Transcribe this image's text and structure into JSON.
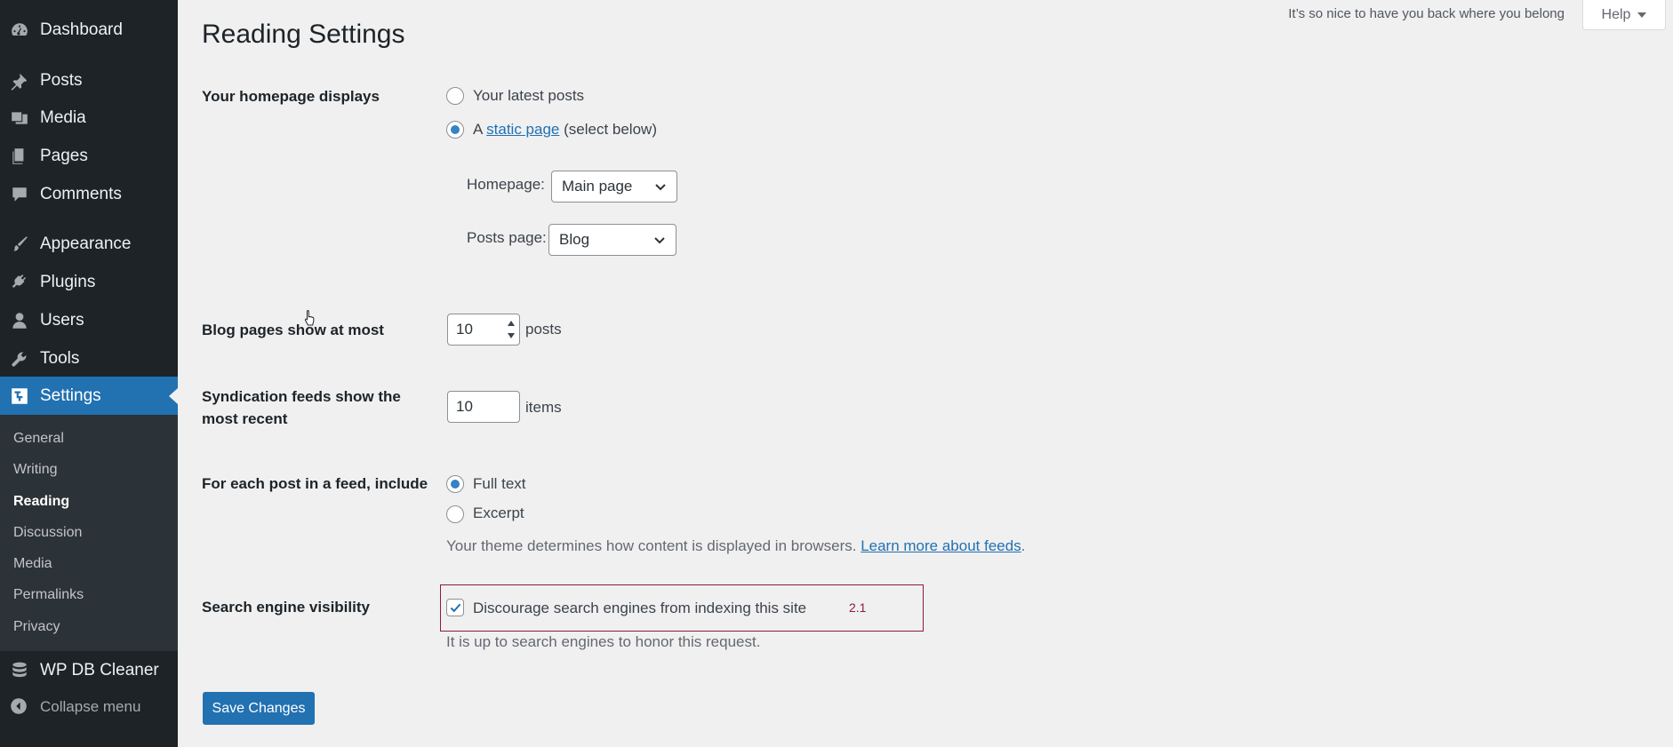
{
  "sidebar": {
    "items": [
      {
        "label": "Dashboard",
        "icon": "dashboard-icon"
      },
      {
        "label": "Posts",
        "icon": "pin-icon"
      },
      {
        "label": "Media",
        "icon": "media-icon"
      },
      {
        "label": "Pages",
        "icon": "pages-icon"
      },
      {
        "label": "Comments",
        "icon": "comment-icon"
      },
      {
        "label": "Appearance",
        "icon": "brush-icon"
      },
      {
        "label": "Plugins",
        "icon": "plug-icon"
      },
      {
        "label": "Users",
        "icon": "user-icon"
      },
      {
        "label": "Tools",
        "icon": "wrench-icon"
      },
      {
        "label": "Settings",
        "icon": "settings-icon"
      }
    ],
    "submenu": [
      "General",
      "Writing",
      "Reading",
      "Discussion",
      "Media",
      "Permalinks",
      "Privacy"
    ],
    "current_submenu": "Reading",
    "extra_item": {
      "label": "WP DB Cleaner",
      "icon": "database-icon"
    },
    "collapse_label": "Collapse menu"
  },
  "header": {
    "welcome_text": "It’s so nice to have you back where you belong",
    "help_label": "Help"
  },
  "page": {
    "title": "Reading Settings",
    "homepage": {
      "label": "Your homepage displays",
      "option_latest": "Your latest posts",
      "option_static_prefix": "A",
      "option_static_link": "static page",
      "option_static_suffix": "(select below)",
      "selected": "static",
      "homepage_label": "Homepage:",
      "homepage_value": "Main page",
      "posts_page_label": "Posts page:",
      "posts_page_value": "Blog"
    },
    "blog_pages": {
      "label": "Blog pages show at most",
      "value": "10",
      "unit": "posts"
    },
    "syndication": {
      "label": "Syndication feeds show the most recent",
      "value": "10",
      "unit": "items"
    },
    "feed_include": {
      "label": "For each post in a feed, include",
      "option_full": "Full text",
      "option_excerpt": "Excerpt",
      "selected": "full",
      "desc_text": "Your theme determines how content is displayed in browsers.",
      "desc_link": "Learn more about feeds",
      "desc_end": "."
    },
    "search_visibility": {
      "label": "Search engine visibility",
      "checkbox_label": "Discourage search engines from indexing this site",
      "checked": true,
      "note": "It is up to search engines to honor this request.",
      "annotation": "2.1"
    },
    "save_label": "Save Changes"
  },
  "colors": {
    "sidebar_bg": "#1d2327",
    "submenu_bg": "#2c3338",
    "accent": "#2271b1",
    "page_bg": "#f0f0f1",
    "highlight": "#8b1c3b"
  }
}
